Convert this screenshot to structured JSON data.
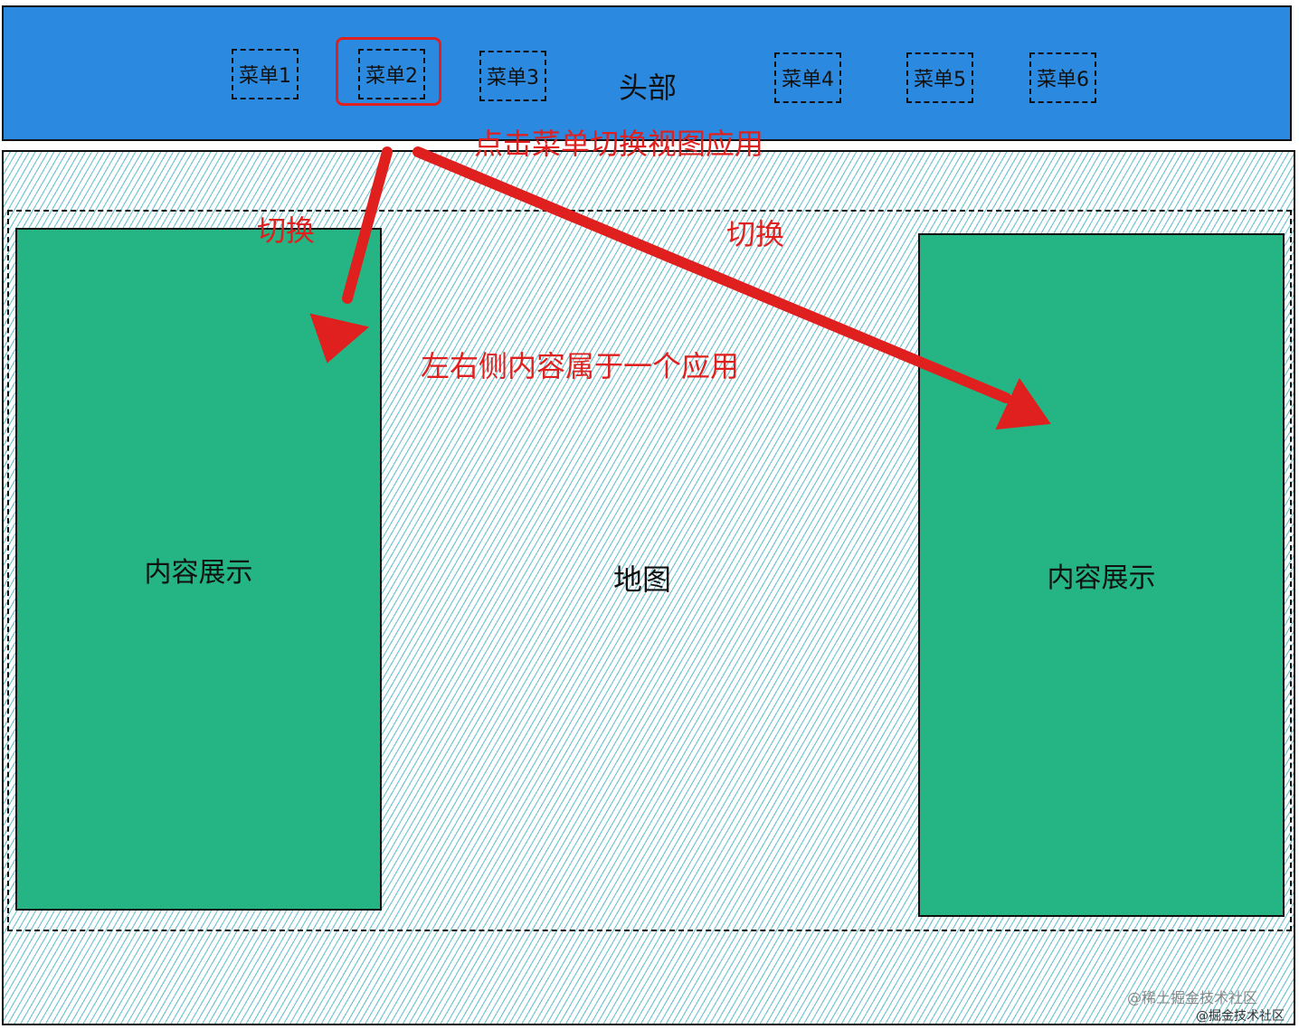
{
  "header": {
    "title": "头部",
    "menus": [
      "菜单1",
      "菜单2",
      "菜单3",
      "菜单4",
      "菜单5",
      "菜单6"
    ],
    "highlighted_menu": "菜单2"
  },
  "main": {
    "map_label": "地图",
    "left_panel_label": "内容展示",
    "right_panel_label": "内容展示"
  },
  "annotations": {
    "top": "点击菜单切换视图应用",
    "switch_left": "切换",
    "switch_right": "切换",
    "same_app": "左右侧内容属于一个应用"
  },
  "watermark": {
    "line1": "@稀土掘金技术社区",
    "line2": "@掘金技术社区"
  },
  "colors": {
    "header": "#2b8ae0",
    "panel": "#25b585",
    "hatch": "#48b2c3",
    "annotation": "#e0201e"
  }
}
